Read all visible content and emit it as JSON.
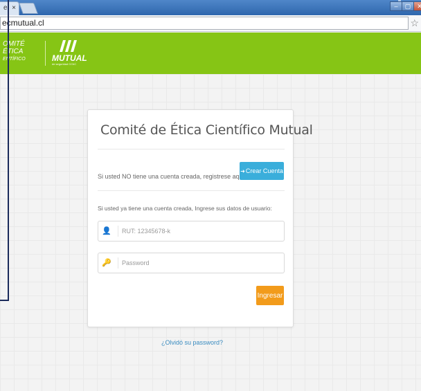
{
  "browser": {
    "tab_label": "e",
    "tab_close": "×",
    "url": "ecmutual.cl",
    "bookmark_icon": "☆",
    "window_controls": [
      "–",
      "▢",
      "✕"
    ]
  },
  "header": {
    "logo_comite_lines": [
      "OMITÉ",
      "ÉTICA",
      "ENTÍFICO"
    ],
    "logo_mutual_word": "MUTUAL",
    "logo_mutual_sub": "de seguridad CChC",
    "brand_color": "#86c515"
  },
  "card": {
    "title": "Comité de Ética Científico Mutual",
    "register_text": "Si usted NO tiene una cuenta creada, registrese aqui",
    "create_account_label": "Crear Cuenta",
    "login_text": "Si usted ya tiene una cuenta creada, Ingrese sus datos de usuario:",
    "rut_placeholder": "RUT: 12345678-k",
    "password_placeholder": "Password",
    "submit_label": "Ingresar",
    "accent_blue": "#3aaedb",
    "accent_orange": "#f29b1b"
  },
  "footer": {
    "forgot_password": "¿Olvidó su password?"
  }
}
